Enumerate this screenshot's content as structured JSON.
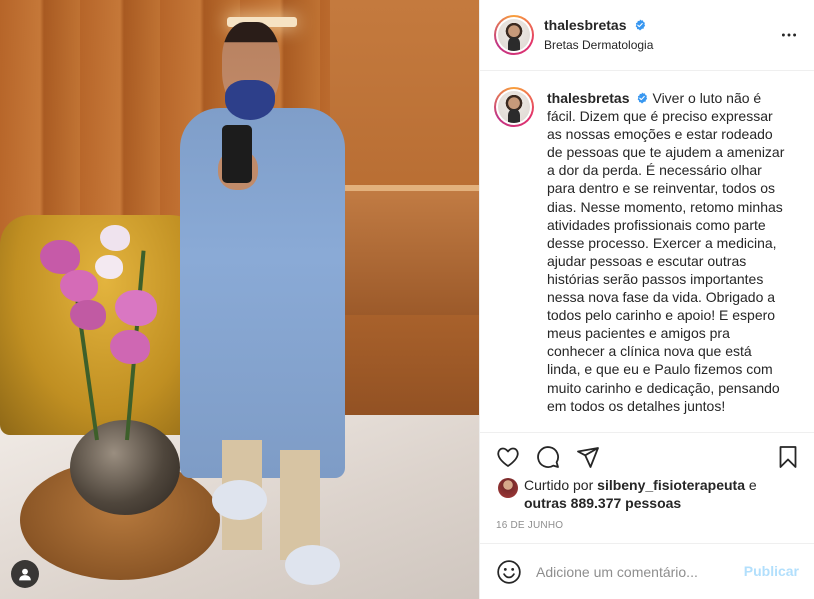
{
  "post": {
    "user_tag_icon": "user-tag-icon"
  },
  "header": {
    "username": "thalesbretas",
    "verified_icon": "verified-badge-icon",
    "location": "Bretas Dermatologia",
    "more_icon": "more-options-icon"
  },
  "caption": {
    "username": "thalesbretas",
    "text": "Viver o luto não é fácil. Dizem que é preciso expressar as nossas emoções e estar rodeado de pessoas que te ajudem a amenizar a dor da perda. É necessário olhar para dentro e se reinventar, todos os dias. Nesse momento, retomo minhas atividades profissionais como parte desse processo. Exercer a medicina, ajudar pessoas e escutar outras histórias serão passos importantes nessa nova fase da vida. Obrigado a todos pelo carinho e apoio! E espero meus pacientes e amigos pra conhecer a clínica nova que está linda, e que eu e Paulo fizemos com muito carinho e dedicação, pensando em todos os detalhes juntos!"
  },
  "actions": {
    "like_icon": "heart-icon",
    "comment_icon": "comment-icon",
    "share_icon": "share-icon",
    "save_icon": "bookmark-icon"
  },
  "likes": {
    "prefix": "Curtido por",
    "liker": "silbeny_fisioterapeuta",
    "conjunction": "e",
    "others": "outras 889.377 pessoas"
  },
  "date": "16 DE JUNHO",
  "comment": {
    "emoji_icon": "emoji-icon",
    "placeholder": "Adicione um comentário...",
    "publish_label": "Publicar"
  },
  "colors": {
    "link_disabled": "#b2dffc",
    "verified": "#3897f0",
    "muted": "#8e8e8e"
  }
}
